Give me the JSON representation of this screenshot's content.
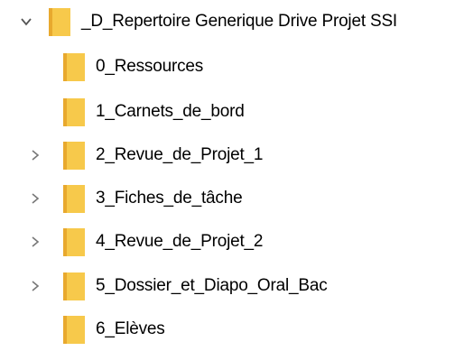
{
  "tree": {
    "root": {
      "label": "_D_Repertoire Generique Drive Projet SSI",
      "expanded": true,
      "icon": "folder-icon"
    },
    "children": [
      {
        "label": "0_Ressources",
        "expandable": false,
        "icon": "folder-icon"
      },
      {
        "label": "1_Carnets_de_bord",
        "expandable": false,
        "icon": "folder-icon"
      },
      {
        "label": "2_Revue_de_Projet_1",
        "expandable": true,
        "icon": "folder-icon"
      },
      {
        "label": "3_Fiches_de_tâche",
        "expandable": true,
        "icon": "folder-icon"
      },
      {
        "label": "4_Revue_de_Projet_2",
        "expandable": true,
        "icon": "folder-icon"
      },
      {
        "label": "5_Dossier_et_Diapo_Oral_Bac",
        "expandable": true,
        "icon": "folder-icon"
      },
      {
        "label": "6_Elèves",
        "expandable": false,
        "icon": "folder-icon"
      }
    ]
  },
  "colors": {
    "folder_front": "#F7C94B",
    "folder_back": "#E8A92E",
    "chevron": "#6B6B6B"
  }
}
